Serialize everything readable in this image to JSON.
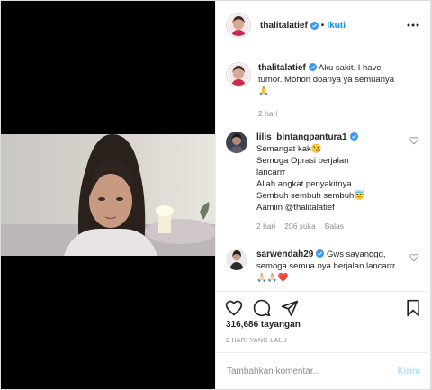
{
  "header": {
    "username": "thalitalatief",
    "separator": "•",
    "follow_label": "Ikuti"
  },
  "caption": {
    "username": "thalitalatief",
    "text": "Aku sakit. I have tumor. Mohon doanya ya semuanya 🙏",
    "time": "2 hari"
  },
  "comments": [
    {
      "username": "lilis_bintangpantura1",
      "lines": [
        "Semangat kak😘",
        "Semoga Oprasi berjalan",
        "lancarrr",
        "Allah angkat penyakitnya",
        "Sembuh sembuh sembuh😇",
        "Aamiin @thalitalatief"
      ],
      "time": "2 hari",
      "likes": "206 suka",
      "reply_label": "Balas"
    },
    {
      "username": "sarwendah29",
      "text": "Gws sayanggg, semoga semua nya berjalan lancarrr🙏🏻🙏🏻❤️"
    }
  ],
  "stats": {
    "views": "316,686 tayangan",
    "posted": "2 HARI YANG LALU"
  },
  "comment_box": {
    "placeholder": "Tambahkan komentar...",
    "post_label": "Kirim"
  },
  "colors": {
    "accent": "#0095f6",
    "verified": "#3897f0",
    "muted": "#8e8e8e",
    "post_disabled": "#b2dffc"
  },
  "icons": [
    "more-options-icon",
    "verified-icon",
    "heart-icon",
    "comment-icon",
    "share-icon",
    "bookmark-icon"
  ]
}
